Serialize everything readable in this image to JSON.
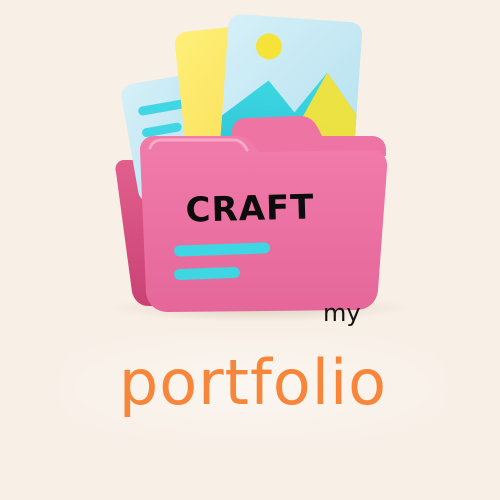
{
  "graphic": {
    "folder_icon": "folder-icon",
    "picture_icon": "image-icon",
    "folder_label": "CRAFT"
  },
  "caption": {
    "small": "my",
    "large": "portfolio"
  },
  "colors": {
    "background": "#f8efe6",
    "folder_pink": "#ec6fa0",
    "card_yellow": "#fde562",
    "card_blue": "#bfe5f2",
    "accent_cyan": "#3fd6e3",
    "accent_orange": "#f8863a",
    "sun_yellow": "#f6e33a"
  }
}
